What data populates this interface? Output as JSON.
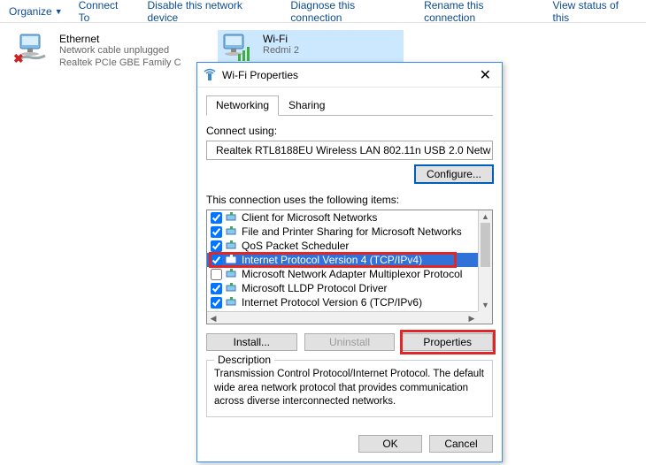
{
  "toolbar": {
    "organize": "Organize",
    "connect_to": "Connect To",
    "disable": "Disable this network device",
    "diagnose": "Diagnose this connection",
    "rename": "Rename this connection",
    "view_status": "View status of this"
  },
  "adapters": {
    "ethernet": {
      "title": "Ethernet",
      "line1": "Network cable unplugged",
      "line2": "Realtek PCIe GBE Family C"
    },
    "wifi": {
      "title": "Wi-Fi",
      "line1": "Redmi 2",
      "line2": ""
    }
  },
  "dialog": {
    "title": "Wi-Fi Properties",
    "tab_networking": "Networking",
    "tab_sharing": "Sharing",
    "connect_using_label": "Connect using:",
    "adapter_name": "Realtek RTL8188EU Wireless LAN 802.11n USB 2.0 Netw",
    "configure_btn": "Configure...",
    "list_label": "This connection uses the following items:",
    "items": [
      {
        "checked": true,
        "label": "Client for Microsoft Networks"
      },
      {
        "checked": true,
        "label": "File and Printer Sharing for Microsoft Networks"
      },
      {
        "checked": true,
        "label": "QoS Packet Scheduler"
      },
      {
        "checked": true,
        "label": "Internet Protocol Version 4 (TCP/IPv4)",
        "selected": true
      },
      {
        "checked": false,
        "label": "Microsoft Network Adapter Multiplexor Protocol"
      },
      {
        "checked": true,
        "label": "Microsoft LLDP Protocol Driver"
      },
      {
        "checked": true,
        "label": "Internet Protocol Version 6 (TCP/IPv6)"
      }
    ],
    "install_btn": "Install...",
    "uninstall_btn": "Uninstall",
    "properties_btn": "Properties",
    "description_label": "Description",
    "description_text": "Transmission Control Protocol/Internet Protocol. The default wide area network protocol that provides communication across diverse interconnected networks.",
    "ok_btn": "OK",
    "cancel_btn": "Cancel"
  }
}
